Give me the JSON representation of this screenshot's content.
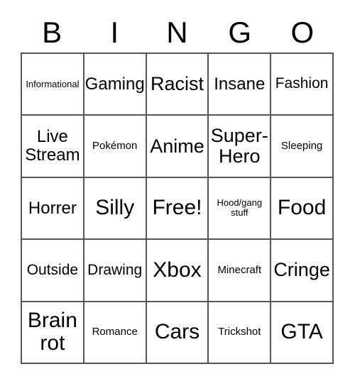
{
  "card": {
    "header_letters": [
      "B",
      "I",
      "N",
      "G",
      "O"
    ],
    "grid": {
      "columns": 5,
      "rows": 5,
      "border_color": "#555555",
      "background_color": "#ffffff",
      "text_color": "#000000"
    },
    "cells": [
      {
        "text": "Informational",
        "size": "fs-xs",
        "row": 1,
        "col": 1
      },
      {
        "text": "Gaming",
        "size": "fs-lg",
        "row": 1,
        "col": 2
      },
      {
        "text": "Racist",
        "size": "fs-xl",
        "row": 1,
        "col": 3
      },
      {
        "text": "Insane",
        "size": "fs-lg",
        "row": 1,
        "col": 4
      },
      {
        "text": "Fashion",
        "size": "fs-md",
        "row": 1,
        "col": 5
      },
      {
        "text": "Live\nStream",
        "size": "fs-lg",
        "row": 2,
        "col": 1
      },
      {
        "text": "Pokémon",
        "size": "fs-sm",
        "row": 2,
        "col": 2
      },
      {
        "text": "Anime",
        "size": "fs-xl",
        "row": 2,
        "col": 3
      },
      {
        "text": "Super-\nHero",
        "size": "fs-xl",
        "row": 2,
        "col": 4
      },
      {
        "text": "Sleeping",
        "size": "fs-sm",
        "row": 2,
        "col": 5
      },
      {
        "text": "Horrer",
        "size": "fs-lg",
        "row": 3,
        "col": 1
      },
      {
        "text": "Silly",
        "size": "fs-xxl",
        "row": 3,
        "col": 2
      },
      {
        "text": "Free!",
        "size": "fs-xxl",
        "row": 3,
        "col": 3
      },
      {
        "text": "Hood/gang\nstuff",
        "size": "fs-xs",
        "row": 3,
        "col": 4
      },
      {
        "text": "Food",
        "size": "fs-xxl",
        "row": 3,
        "col": 5
      },
      {
        "text": "Outside",
        "size": "fs-md",
        "row": 4,
        "col": 1
      },
      {
        "text": "Drawing",
        "size": "fs-md",
        "row": 4,
        "col": 2
      },
      {
        "text": "Xbox",
        "size": "fs-xxl",
        "row": 4,
        "col": 3
      },
      {
        "text": "Minecraft",
        "size": "fs-sm",
        "row": 4,
        "col": 4
      },
      {
        "text": "Cringe",
        "size": "fs-xl",
        "row": 4,
        "col": 5
      },
      {
        "text": "Brain\nrot",
        "size": "fs-xxl",
        "row": 5,
        "col": 1
      },
      {
        "text": "Romance",
        "size": "fs-sm",
        "row": 5,
        "col": 2
      },
      {
        "text": "Cars",
        "size": "fs-xxl",
        "row": 5,
        "col": 3
      },
      {
        "text": "Trickshot",
        "size": "fs-sm",
        "row": 5,
        "col": 4
      },
      {
        "text": "GTA",
        "size": "fs-xxl",
        "row": 5,
        "col": 5
      }
    ]
  }
}
